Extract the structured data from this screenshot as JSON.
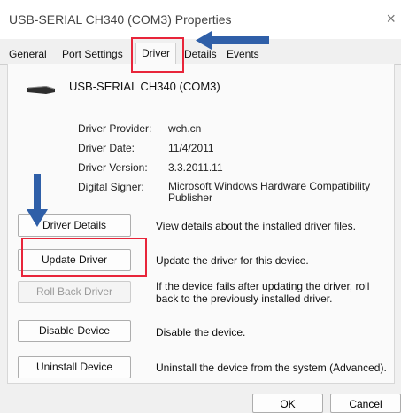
{
  "window": {
    "title": "USB-SERIAL CH340 (COM3) Properties",
    "close_glyph": "×"
  },
  "tabs": [
    {
      "label": "General"
    },
    {
      "label": "Port Settings"
    },
    {
      "label": "Driver",
      "active": true
    },
    {
      "label": "Details"
    },
    {
      "label": "Events"
    }
  ],
  "device": {
    "name": "USB-SERIAL CH340 (COM3)",
    "icon": "usb-cable-icon"
  },
  "info": [
    {
      "label": "Driver Provider:",
      "value": "wch.cn"
    },
    {
      "label": "Driver Date:",
      "value": "11/4/2011"
    },
    {
      "label": "Driver Version:",
      "value": "3.3.2011.11"
    },
    {
      "label": "Digital Signer:",
      "value": "Microsoft Windows Hardware Compatibility Publisher"
    }
  ],
  "actions": [
    {
      "label": "Driver Details",
      "description": "View details about the installed driver files."
    },
    {
      "label": "Update Driver",
      "description": "Update the driver for this device."
    },
    {
      "label": "Roll Back Driver",
      "description": "If the device fails after updating the driver, roll back to the previously installed driver.",
      "disabled": true
    },
    {
      "label": "Disable Device",
      "description": "Disable the device."
    },
    {
      "label": "Uninstall Device",
      "description": "Uninstall the device from the system (Advanced)."
    }
  ],
  "footer": {
    "ok": "OK",
    "cancel": "Cancel"
  },
  "annotations": {
    "highlight_color": "#e8253a",
    "arrow_color": "#2f5fa8"
  }
}
